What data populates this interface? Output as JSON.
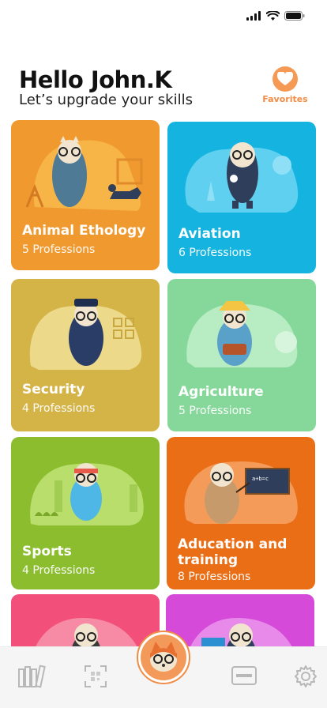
{
  "header": {
    "greeting": "Hello John.K",
    "subtitle": "Let’s upgrade your skills",
    "favorites_label": "Favorites"
  },
  "categories": [
    {
      "title": "Animal Ethology",
      "count": "5 Professions",
      "color": "#f0992f",
      "scene_color": "#f7b447"
    },
    {
      "title": "Aviation",
      "count": "6 Professions",
      "color": "#15b4e0",
      "scene_color": "#5fd0ef"
    },
    {
      "title": "Security",
      "count": "4 Professions",
      "color": "#d4b347",
      "scene_color": "#ecd98a"
    },
    {
      "title": "Agriculture",
      "count": "5 Professions",
      "color": "#86d89a",
      "scene_color": "#b8ecc3"
    },
    {
      "title": "Sports",
      "count": "4 Professions",
      "color": "#8bbd2f",
      "scene_color": "#b9de6c"
    },
    {
      "title": "Aducation and training",
      "count": "8 Professions",
      "color": "#ea6e16",
      "scene_color": "#f59b59"
    },
    {
      "title": "",
      "count": "",
      "color": "#f2507a",
      "scene_color": "#f78aa5"
    },
    {
      "title": "",
      "count": "",
      "color": "#d54ad8",
      "scene_color": "#e88ae9"
    }
  ],
  "nav": {
    "items": [
      "library-icon",
      "qr-scan-icon",
      "home-mascot-icon",
      "card-icon",
      "gear-icon"
    ]
  }
}
